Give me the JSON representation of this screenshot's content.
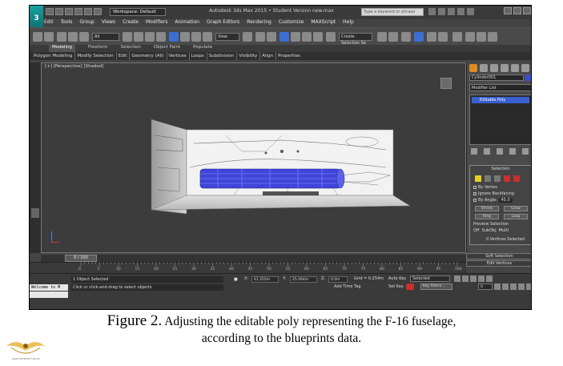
{
  "titlebar": {
    "logo": "3",
    "workspace": "Workspace: Default",
    "app_title": "Autodesk 3ds Max 2015 • Student Version   new.max",
    "search_placeholder": "Type a keyword or phrase"
  },
  "menubar": [
    "Edit",
    "Tools",
    "Group",
    "Views",
    "Create",
    "Modifiers",
    "Animation",
    "Graph Editors",
    "Rendering",
    "Customize",
    "MAXScript",
    "Help"
  ],
  "toolbar": {
    "filter": "All",
    "ref_coord": "View",
    "named_sel": "Create Selection Se"
  },
  "ribbon": {
    "tabs": [
      "Modeling",
      "Freeform",
      "Selection",
      "Object Paint",
      "Populate"
    ],
    "active_tab": "Modeling",
    "sub": [
      "Polygon Modeling",
      "Modify Selection",
      "Edit",
      "Geometry (All)",
      "Vertices",
      "Loops",
      "Subdivision",
      "Visibility",
      "Align",
      "Properties"
    ]
  },
  "viewport": {
    "label": "[+] [Perspective] [Shaded]"
  },
  "command_panel": {
    "object_name": "Cylinder001",
    "modifier_list": "Modifier List",
    "stack_item": "Editable Poly",
    "selection_title": "Selection",
    "by_vertex": "By Vertex",
    "ignore_backfacing": "Ignore Backfacing",
    "by_angle": "By Angle:",
    "by_angle_val": "45.0",
    "shrink": "Shrink",
    "grow": "Grow",
    "ring": "Ring",
    "loop": "Loop",
    "preview_selection": "Preview Selection",
    "preview_off": "Off",
    "preview_subobj": "SubObj",
    "preview_multi": "Multi",
    "vertices_selected": "0 Vertices Selected",
    "soft_selection": "Soft Selection",
    "edit_vertices": "Edit Vertices"
  },
  "timeline": {
    "frame_counter": "0 / 100",
    "ticks": [
      "0",
      "5",
      "10",
      "15",
      "20",
      "25",
      "30",
      "35",
      "40",
      "45",
      "50",
      "55",
      "60",
      "65",
      "70",
      "75",
      "80",
      "85",
      "90",
      "95",
      "100"
    ]
  },
  "statusbar": {
    "welcome": "Welcome to M",
    "status_line1": "1 Object Selected",
    "status_line2": "Click or click-and-drag to select objects",
    "x_label": "X:",
    "x_val": "41.355m",
    "y_label": "Y:",
    "y_val": "25.064m",
    "z_label": "Z:",
    "z_val": "0.0m",
    "grid": "Grid = 0.254m",
    "add_time_tag": "Add Time Tag",
    "auto_key": "Auto Key",
    "auto_key_sel": "Selected",
    "set_key": "Set Key",
    "key_filters": "Key Filters...",
    "frame": "0"
  },
  "caption": {
    "fig": "Figure 2.",
    "line1": " Adjusting the editable poly representing the F-16 fuselage,",
    "line2": "according to the blueprints data."
  },
  "watermark": {
    "text": "ARAB DEFENSE FORUM"
  }
}
